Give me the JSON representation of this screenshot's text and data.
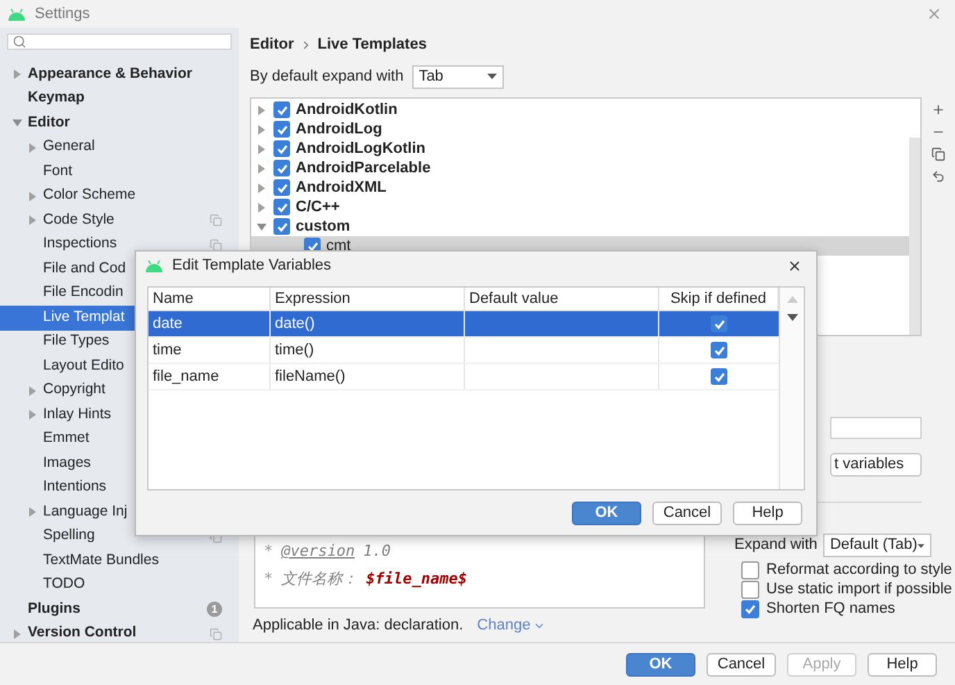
{
  "window": {
    "title": "Settings"
  },
  "sidebar": {
    "items": [
      {
        "label": "Appearance & Behavior",
        "expanded": false,
        "selected": false
      },
      {
        "label": "Keymap",
        "selected": false
      },
      {
        "label": "Editor",
        "expanded": true,
        "selected": false,
        "children": [
          {
            "label": "General",
            "expanded": false,
            "selected": false
          },
          {
            "label": "Font",
            "selected": false
          },
          {
            "label": "Color Scheme",
            "expanded": false,
            "selected": false
          },
          {
            "label": "Code Style",
            "expanded": false,
            "selected": false,
            "copy_icon": true
          },
          {
            "label": "Inspections",
            "selected": false,
            "copy_icon": true
          },
          {
            "label": "File and Cod",
            "selected": false
          },
          {
            "label": "File Encodin",
            "selected": false
          },
          {
            "label": "Live Templat",
            "selected": true
          },
          {
            "label": "File Types",
            "selected": false
          },
          {
            "label": "Layout Edito",
            "selected": false
          },
          {
            "label": "Copyright",
            "expanded": false,
            "selected": false
          },
          {
            "label": "Inlay Hints",
            "expanded": false,
            "selected": false
          },
          {
            "label": "Emmet",
            "selected": false
          },
          {
            "label": "Images",
            "selected": false
          },
          {
            "label": "Intentions",
            "selected": false
          },
          {
            "label": "Language Inj",
            "expanded": false,
            "selected": false
          },
          {
            "label": "Spelling",
            "selected": false,
            "copy_icon": true
          },
          {
            "label": "TextMate Bundles",
            "selected": false
          },
          {
            "label": "TODO",
            "selected": false
          }
        ]
      },
      {
        "label": "Plugins",
        "selected": false,
        "badge": "1"
      },
      {
        "label": "Version Control",
        "expanded": false,
        "selected": false,
        "copy_icon": true
      }
    ]
  },
  "breadcrumb": [
    "Editor",
    "Live Templates"
  ],
  "expand_default": {
    "label": "By default expand with",
    "value": "Tab"
  },
  "template_groups": [
    {
      "label": "AndroidKotlin",
      "checked": true,
      "expanded": false,
      "selected": false
    },
    {
      "label": "AndroidLog",
      "checked": true,
      "expanded": false,
      "selected": false
    },
    {
      "label": "AndroidLogKotlin",
      "checked": true,
      "expanded": false,
      "selected": false
    },
    {
      "label": "AndroidParcelable",
      "checked": true,
      "expanded": false,
      "selected": false
    },
    {
      "label": "AndroidXML",
      "checked": true,
      "expanded": false,
      "selected": false
    },
    {
      "label": "C/C++",
      "checked": true,
      "expanded": false,
      "selected": false
    },
    {
      "label": "custom",
      "checked": true,
      "expanded": true,
      "selected": false,
      "children": [
        {
          "label": "cmt",
          "checked": true,
          "selected": true
        }
      ]
    }
  ],
  "edit_variables_button": {
    "label": "t variables"
  },
  "template_text": {
    "lines": [
      [
        {
          "kind": "plain",
          "text": "*"
        },
        {
          "kind": "tag",
          "text": "@version"
        },
        {
          "kind": "value",
          "text": "1.0"
        }
      ],
      [
        {
          "kind": "plain",
          "text": "*"
        },
        {
          "kind": "comment",
          "text": "文件名称："
        },
        {
          "kind": "variable",
          "text": "$file_name$"
        }
      ]
    ]
  },
  "applicable": {
    "text": "Applicable in Java: declaration.",
    "link": "Change"
  },
  "options": {
    "expand_with": {
      "label": "Expand with",
      "value": "Default (Tab)"
    },
    "checkboxes": [
      {
        "label": "Reformat according to style",
        "checked": false
      },
      {
        "label": "Use static import if possible",
        "checked": false
      },
      {
        "label": "Shorten FQ names",
        "checked": true
      }
    ]
  },
  "dialog": {
    "title": "Edit Template Variables",
    "columns": [
      "Name",
      "Expression",
      "Default value",
      "Skip if defined"
    ],
    "rows": [
      {
        "name": "date",
        "expression": "date()",
        "skip_if_defined": true,
        "selected": true
      },
      {
        "name": "time",
        "expression": "time()",
        "skip_if_defined": true,
        "selected": false
      },
      {
        "name": "file_name",
        "expression": "fileName()",
        "skip_if_defined": true,
        "selected": false
      }
    ],
    "buttons": [
      {
        "label": "OK",
        "kind": "primary"
      },
      {
        "label": "Cancel",
        "kind": "normal"
      },
      {
        "label": "Help",
        "kind": "normal"
      }
    ]
  },
  "buttons": [
    {
      "label": "OK",
      "kind": "primary",
      "disabled": false
    },
    {
      "label": "Cancel",
      "kind": "normal",
      "disabled": false
    },
    {
      "label": "Apply",
      "kind": "normal",
      "disabled": true
    },
    {
      "label": "Help",
      "kind": "normal",
      "disabled": false
    }
  ]
}
